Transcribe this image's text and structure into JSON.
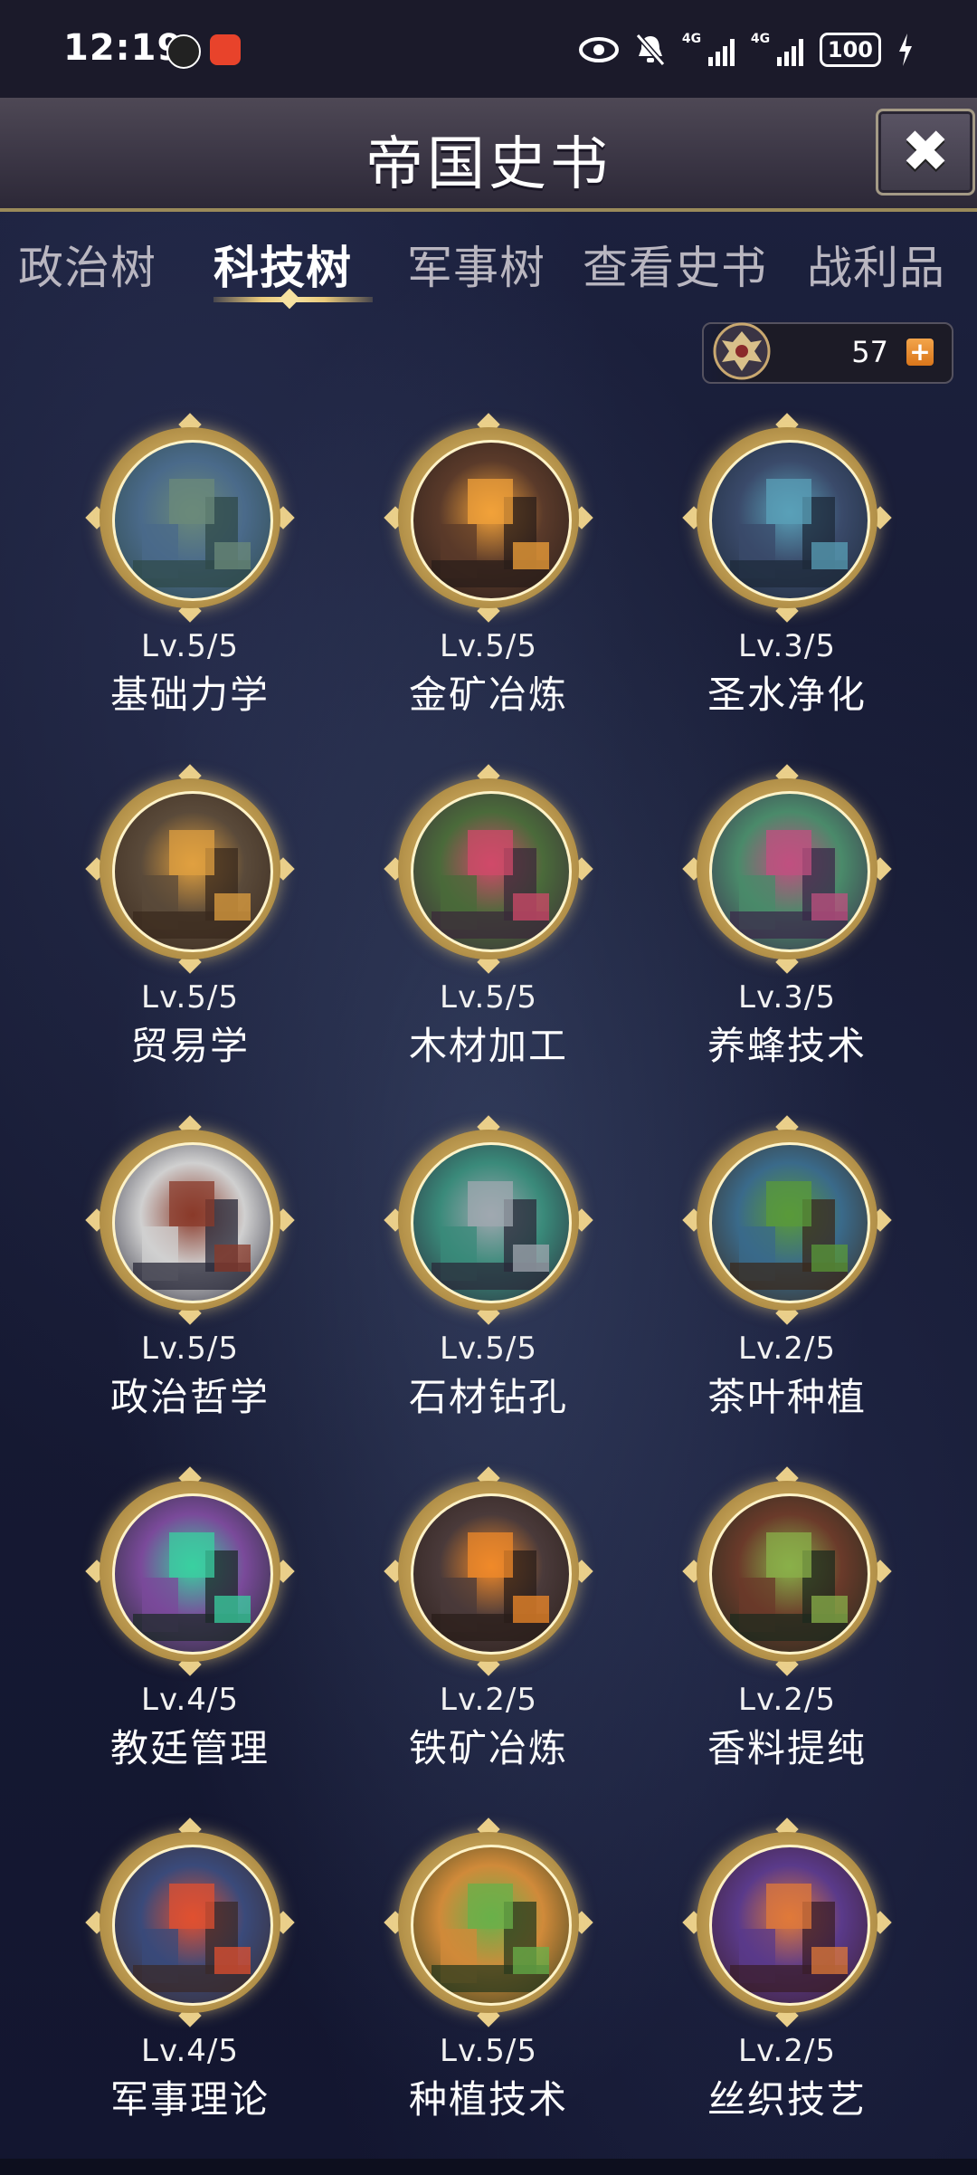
{
  "status_bar": {
    "time": "12:19",
    "signal1_label": "4G",
    "signal2_label": "4G",
    "battery": "100"
  },
  "header": {
    "title": "帝国史书",
    "close_label": "✖"
  },
  "tabs": [
    {
      "label": "政治树",
      "active": false
    },
    {
      "label": "科技树",
      "active": true
    },
    {
      "label": "军事树",
      "active": false
    },
    {
      "label": "查看史书",
      "active": false
    },
    {
      "label": "战利品",
      "active": false
    }
  ],
  "currency": {
    "icon": "eagle-emblem-icon",
    "value": "57",
    "add_label": "+"
  },
  "skills": [
    {
      "level": "Lv.5/5",
      "name": "基础力学",
      "icon": "statue-icon",
      "colors": [
        "#2f4a4a",
        "#6b8a7a",
        "#4a6a8a"
      ]
    },
    {
      "level": "Lv.5/5",
      "name": "金矿冶炼",
      "icon": "furnace-icon",
      "colors": [
        "#2a1e1a",
        "#f2a23a",
        "#5a3a2a"
      ]
    },
    {
      "level": "Lv.3/5",
      "name": "圣水净化",
      "icon": "shrine-icon",
      "colors": [
        "#1e2a3a",
        "#5aa0b8",
        "#3a4a6a"
      ]
    },
    {
      "level": "Lv.5/5",
      "name": "贸易学",
      "icon": "market-icon",
      "colors": [
        "#3a2a1e",
        "#e0a040",
        "#5a4a3a"
      ]
    },
    {
      "level": "Lv.5/5",
      "name": "木材加工",
      "icon": "forest-icon",
      "colors": [
        "#3a2a3a",
        "#d04a6a",
        "#4a6a3a"
      ]
    },
    {
      "level": "Lv.3/5",
      "name": "养蜂技术",
      "icon": "beehive-icon",
      "colors": [
        "#3a2a4a",
        "#c05080",
        "#4a8a6a"
      ]
    },
    {
      "level": "Lv.5/5",
      "name": "政治哲学",
      "icon": "philosopher-icon",
      "colors": [
        "#2a2a3a",
        "#8a3a2a",
        "#d0d0d0"
      ]
    },
    {
      "level": "Lv.5/5",
      "name": "石材钻孔",
      "icon": "drill-icon",
      "colors": [
        "#2a2a3a",
        "#a0a8b0",
        "#3a8a7a"
      ]
    },
    {
      "level": "Lv.2/5",
      "name": "茶叶种植",
      "icon": "tea-icon",
      "colors": [
        "#3a2a1e",
        "#5a9a3a",
        "#3a6a8a"
      ]
    },
    {
      "level": "Lv.4/5",
      "name": "教廷管理",
      "icon": "cathedral-icon",
      "colors": [
        "#1e2a2a",
        "#3ad0a0",
        "#7a4a9a"
      ]
    },
    {
      "level": "Lv.2/5",
      "name": "铁矿冶炼",
      "icon": "forge-icon",
      "colors": [
        "#2a1e1a",
        "#f08a2a",
        "#4a3a3a"
      ]
    },
    {
      "level": "Lv.2/5",
      "name": "香料提纯",
      "icon": "spice-icon",
      "colors": [
        "#1e2a1e",
        "#8ab04a",
        "#6a3a2a"
      ]
    },
    {
      "level": "Lv.4/5",
      "name": "军事理论",
      "icon": "knight-icon",
      "colors": [
        "#3a2a2a",
        "#e05030",
        "#3a4a7a"
      ]
    },
    {
      "level": "Lv.5/5",
      "name": "种植技术",
      "icon": "farm-icon",
      "colors": [
        "#2a3a1e",
        "#6ab04a",
        "#d08a3a"
      ]
    },
    {
      "level": "Lv.2/5",
      "name": "丝织技艺",
      "icon": "weaving-town-icon",
      "colors": [
        "#3a1e2a",
        "#e07a3a",
        "#5a3a8a"
      ]
    }
  ]
}
